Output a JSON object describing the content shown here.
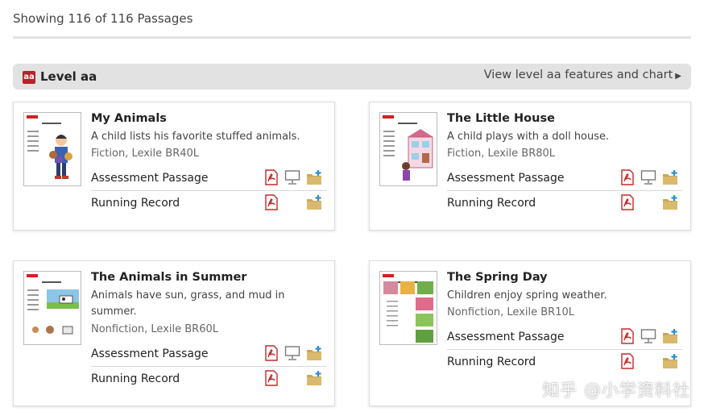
{
  "results": {
    "showing_text": "Showing 116 of 116 Passages"
  },
  "level": {
    "badge": "aa",
    "title": "Level aa",
    "link_text": "View level aa features and chart"
  },
  "cards": [
    {
      "title": "My Animals",
      "description": "A child lists his favorite stuffed animals.",
      "meta": "Fiction, Lexile BR40L",
      "rows": [
        {
          "label": "Assessment Passage",
          "icons": [
            "pdf-icon",
            "projector-icon",
            "add-to-folder-icon"
          ]
        },
        {
          "label": "Running Record",
          "icons": [
            "pdf-icon",
            "add-to-folder-icon"
          ]
        }
      ]
    },
    {
      "title": "The Little House",
      "description": "A child plays with a doll house.",
      "meta": "Fiction, Lexile BR80L",
      "rows": [
        {
          "label": "Assessment Passage",
          "icons": [
            "pdf-icon",
            "projector-icon",
            "add-to-folder-icon"
          ]
        },
        {
          "label": "Running Record",
          "icons": [
            "pdf-icon",
            "add-to-folder-icon"
          ]
        }
      ]
    },
    {
      "title": "The Animals in Summer",
      "description": "Animals have sun, grass, and mud in summer.",
      "meta": "Nonfiction, Lexile BR60L",
      "rows": [
        {
          "label": "Assessment Passage",
          "icons": [
            "pdf-icon",
            "projector-icon",
            "add-to-folder-icon"
          ]
        },
        {
          "label": "Running Record",
          "icons": [
            "pdf-icon",
            "add-to-folder-icon"
          ]
        }
      ]
    },
    {
      "title": "The Spring Day",
      "description": "Children enjoy spring weather.",
      "meta": "Nonfiction, Lexile BR10L",
      "rows": [
        {
          "label": "Assessment Passage",
          "icons": [
            "pdf-icon",
            "projector-icon",
            "add-to-folder-icon"
          ]
        },
        {
          "label": "Running Record",
          "icons": [
            "pdf-icon",
            "add-to-folder-icon"
          ]
        }
      ]
    }
  ],
  "watermark": "知乎 @小学资料社",
  "colors": {
    "brand_red": "#b5232a",
    "level_bar": "#e2e2e2",
    "folder": "#c9a65a",
    "folder_plus": "#2a8fd6"
  }
}
